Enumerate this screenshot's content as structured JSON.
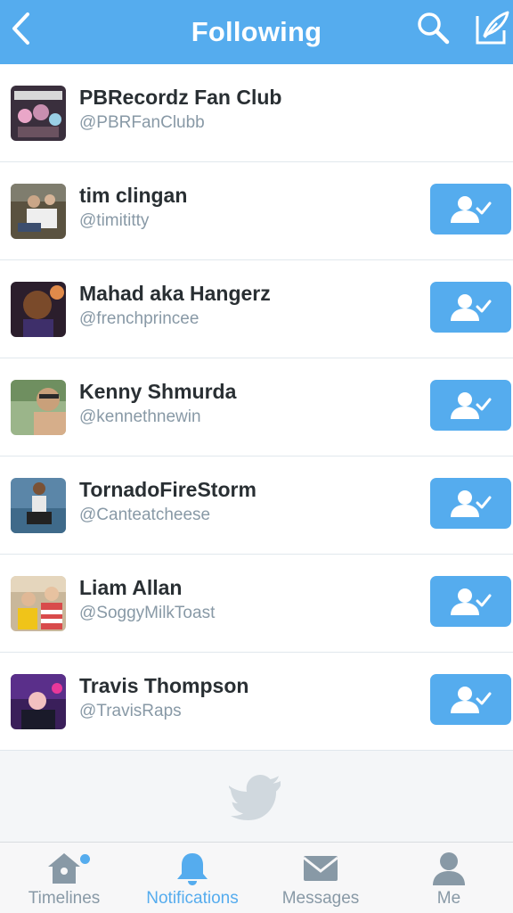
{
  "colors": {
    "accent": "#55acee",
    "name_text": "#292f33",
    "handle_text": "#8899a6",
    "tab_inactive": "#8899a6"
  },
  "header": {
    "title": "Following",
    "back_icon": "chevron-left-icon",
    "search_icon": "search-icon",
    "compose_icon": "compose-icon"
  },
  "users": [
    {
      "name": "PBRecordz Fan Club",
      "handle": "@PBRFanClubb",
      "following_button": false
    },
    {
      "name": "tim clingan",
      "handle": "@timititty",
      "following_button": true
    },
    {
      "name": "Mahad aka Hangerz",
      "handle": "@frenchprincee",
      "following_button": true
    },
    {
      "name": "Kenny Shmurda",
      "handle": "@kennethnewin",
      "following_button": true
    },
    {
      "name": "TornadoFireStorm",
      "handle": "@Canteatcheese",
      "following_button": true
    },
    {
      "name": "Liam Allan",
      "handle": "@SoggyMilkToast",
      "following_button": true
    },
    {
      "name": "Travis Thompson",
      "handle": "@TravisRaps",
      "following_button": true
    }
  ],
  "tabs": [
    {
      "label": "Timelines",
      "icon": "home-icon",
      "active": false,
      "has_dot": true
    },
    {
      "label": "Notifications",
      "icon": "bell-icon",
      "active": true,
      "has_dot": false
    },
    {
      "label": "Messages",
      "icon": "envelope-icon",
      "active": false,
      "has_dot": false
    },
    {
      "label": "Me",
      "icon": "person-icon",
      "active": false,
      "has_dot": false
    }
  ]
}
